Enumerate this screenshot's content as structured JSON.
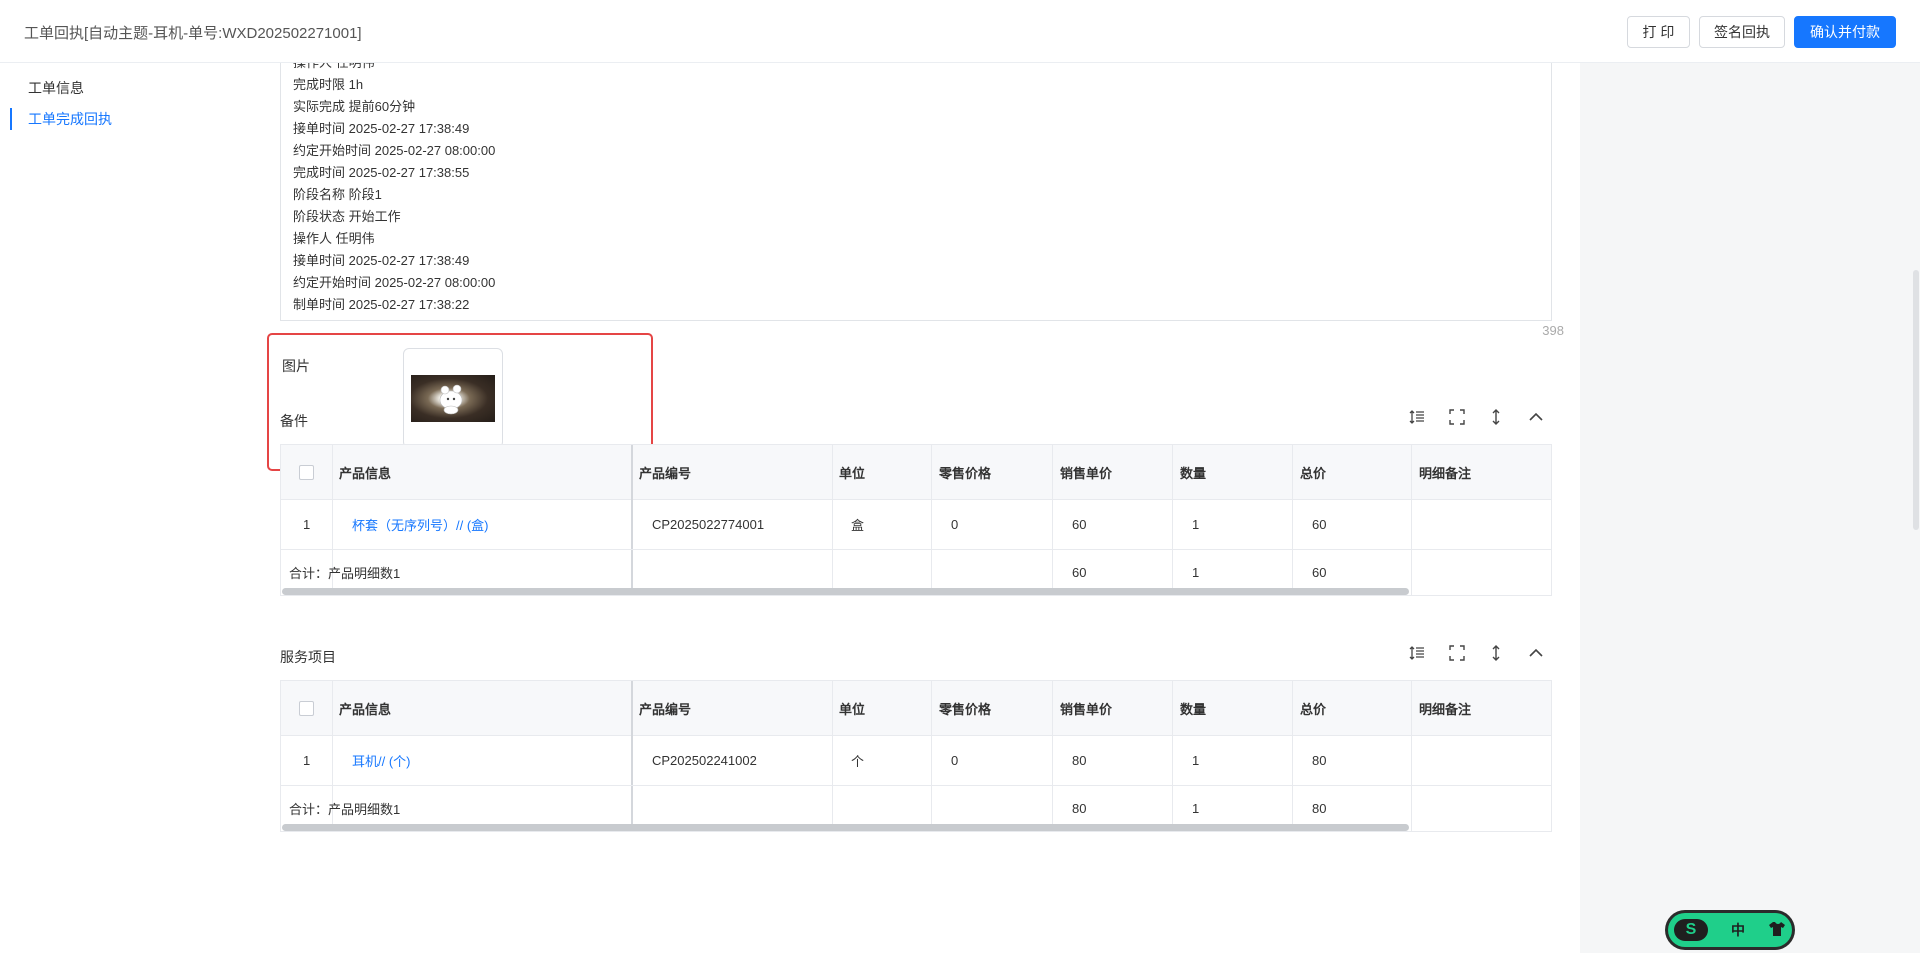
{
  "header": {
    "title": "工单回执[自动主题-耳机-单号:WXD202502271001]",
    "print_label": "打 印",
    "sign_label": "签名回执",
    "confirm_label": "确认并付款"
  },
  "nav": {
    "items": [
      {
        "label": "工单信息",
        "active": false
      },
      {
        "label": "工单完成回执",
        "active": true
      }
    ]
  },
  "log": {
    "lines": [
      "操作人 任明伟",
      "完成时限 1h",
      "实际完成 提前60分钟",
      "接单时间 2025-02-27 17:38:49",
      "约定开始时间 2025-02-27 08:00:00",
      "完成时间 2025-02-27 17:38:55",
      "阶段名称 阶段1",
      "阶段状态 开始工作",
      "操作人 任明伟",
      "接单时间 2025-02-27 17:38:49",
      "约定开始时间 2025-02-27 08:00:00",
      "制单时间 2025-02-27 17:38:22"
    ],
    "char_count": "398"
  },
  "picture": {
    "label": "图片"
  },
  "columns": [
    "产品信息",
    "产品编号",
    "单位",
    "零售价格",
    "销售单价",
    "数量",
    "总价",
    "明细备注"
  ],
  "parts": {
    "title": "备件",
    "rows": [
      {
        "index": "1",
        "product": "杯套（无序列号）// (盒)",
        "code": "CP2025022774001",
        "unit": "盒",
        "retail": "0",
        "price": "60",
        "qty": "1",
        "total": "60",
        "note": ""
      }
    ],
    "summary": {
      "label": "合计：产品明细数1",
      "price": "60",
      "qty": "1",
      "total": "60"
    }
  },
  "services": {
    "title": "服务项目",
    "rows": [
      {
        "index": "1",
        "product": "耳机// (个)",
        "code": "CP202502241002",
        "unit": "个",
        "retail": "0",
        "price": "80",
        "qty": "1",
        "total": "80",
        "note": ""
      }
    ],
    "summary": {
      "label": "合计：产品明细数1",
      "price": "80",
      "qty": "1",
      "total": "80"
    }
  },
  "badge": {
    "logo": "S",
    "lang": "中"
  },
  "icons": [
    "line-height-icon",
    "fullscreen-icon",
    "column-height-icon",
    "collapse-icon",
    "shirt-icon"
  ]
}
